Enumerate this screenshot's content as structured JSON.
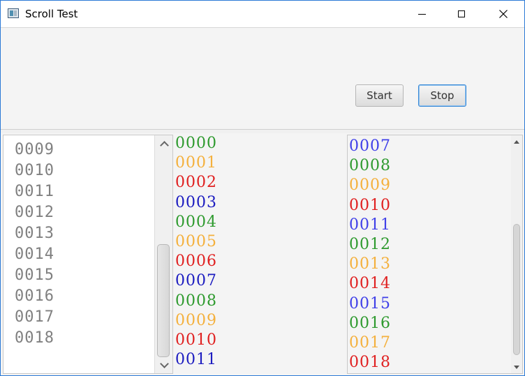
{
  "window": {
    "title": "Scroll Test"
  },
  "toolbar": {
    "start_label": "Start",
    "stop_label": "Stop"
  },
  "list": {
    "items": [
      "0009",
      "0010",
      "0011",
      "0012",
      "0013",
      "0014",
      "0015",
      "0016",
      "0017",
      "0018"
    ]
  },
  "colors": {
    "green": "#2e9a2e",
    "orange": "#f4b03c",
    "red": "#e02020",
    "blue_dark": "#1c1cc0",
    "blue": "#4040e8",
    "accent": "#2b79d6"
  },
  "middle_column": {
    "items": [
      {
        "text": "0000",
        "color": "#2e9a2e"
      },
      {
        "text": "0001",
        "color": "#f4b03c"
      },
      {
        "text": "0002",
        "color": "#e02020"
      },
      {
        "text": "0003",
        "color": "#1c1cc0"
      },
      {
        "text": "0004",
        "color": "#2e9a2e"
      },
      {
        "text": "0005",
        "color": "#f4b03c"
      },
      {
        "text": "0006",
        "color": "#e02020"
      },
      {
        "text": "0007",
        "color": "#1c1cc0"
      },
      {
        "text": "0008",
        "color": "#2e9a2e"
      },
      {
        "text": "0009",
        "color": "#f4b03c"
      },
      {
        "text": "0010",
        "color": "#e02020"
      },
      {
        "text": "0011",
        "color": "#1c1cc0"
      }
    ]
  },
  "right_column": {
    "items": [
      {
        "text": "0007",
        "color": "#4040e8"
      },
      {
        "text": "0008",
        "color": "#2e9a2e"
      },
      {
        "text": "0009",
        "color": "#f4b03c"
      },
      {
        "text": "0010",
        "color": "#e02020"
      },
      {
        "text": "0011",
        "color": "#4040e8"
      },
      {
        "text": "0012",
        "color": "#2e9a2e"
      },
      {
        "text": "0013",
        "color": "#f4b03c"
      },
      {
        "text": "0014",
        "color": "#e02020"
      },
      {
        "text": "0015",
        "color": "#4040e8"
      },
      {
        "text": "0016",
        "color": "#2e9a2e"
      },
      {
        "text": "0017",
        "color": "#f4b03c"
      },
      {
        "text": "0018",
        "color": "#e02020"
      }
    ]
  },
  "icons": {
    "app": "app-window-icon",
    "minimize": "minimize-icon",
    "maximize": "maximize-icon",
    "close": "close-icon",
    "scroll_up": "chevron-up-icon",
    "scroll_down": "chevron-down-icon"
  }
}
